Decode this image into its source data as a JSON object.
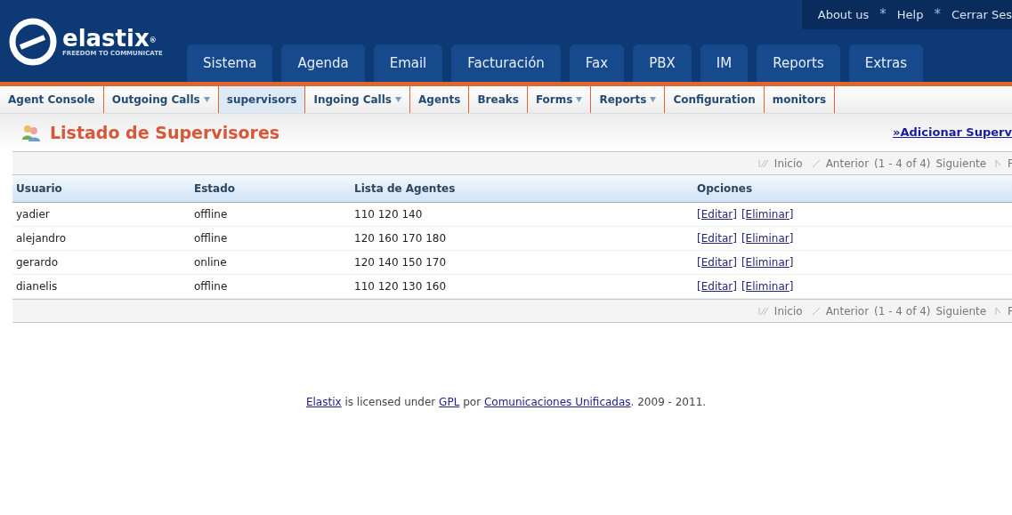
{
  "header": {
    "logo": {
      "name": "elastix",
      "mark": "®",
      "tagline": "FREEDOM TO COMMUNICATE"
    },
    "top_links": [
      {
        "kind": "link",
        "text": "About us"
      },
      {
        "kind": "separator",
        "text": "*"
      },
      {
        "kind": "link",
        "text": "Help"
      },
      {
        "kind": "separator",
        "text": "*"
      },
      {
        "kind": "link",
        "text": "Cerrar Ses"
      }
    ],
    "tabs": [
      {
        "label": "Sistema",
        "selected": false
      },
      {
        "label": "Agenda",
        "selected": false
      },
      {
        "label": "Email",
        "selected": false
      },
      {
        "label": "Facturación",
        "selected": false
      },
      {
        "label": "Fax",
        "selected": false
      },
      {
        "label": "PBX",
        "selected": false
      },
      {
        "label": "IM",
        "selected": false
      },
      {
        "label": "Reports",
        "selected": false
      },
      {
        "label": "Extras",
        "selected": false
      }
    ]
  },
  "submenu": [
    {
      "label": "Agent Console",
      "has_menu": false,
      "selected": false
    },
    {
      "label": "Outgoing Calls",
      "has_menu": true,
      "selected": false
    },
    {
      "label": "supervisors",
      "has_menu": false,
      "selected": true
    },
    {
      "label": "Ingoing Calls",
      "has_menu": true,
      "selected": false
    },
    {
      "label": "Agents",
      "has_menu": false,
      "selected": false
    },
    {
      "label": "Breaks",
      "has_menu": false,
      "selected": false
    },
    {
      "label": "Forms",
      "has_menu": true,
      "selected": false
    },
    {
      "label": "Reports",
      "has_menu": true,
      "selected": false
    },
    {
      "label": "Configuration",
      "has_menu": false,
      "selected": false
    },
    {
      "label": "monitors",
      "has_menu": false,
      "selected": false
    }
  ],
  "page": {
    "title": "Listado de Supervisores",
    "add_link": "»Adicionar Superv"
  },
  "pagination_top": {
    "first": "Inicio",
    "previous": "Anterior",
    "range": "(1 - 4 of 4)",
    "next": "Siguiente",
    "last": "F"
  },
  "pagination_bottom": {
    "first": "Inicio",
    "previous": "Anterior",
    "range": "(1 - 4 of 4)",
    "next": "Siguiente",
    "last": "F"
  },
  "table": {
    "columns": [
      "Usuario",
      "Estado",
      "Lista de Agentes",
      "Opciones"
    ],
    "rows": [
      {
        "user": "yadier",
        "status": "offline",
        "agents": "110 120 140",
        "actions": [
          "[Editar]",
          "[Eliminar]"
        ]
      },
      {
        "user": "alejandro",
        "status": "offline",
        "agents": "120 160 170 180",
        "actions": [
          "[Editar]",
          "[Eliminar]"
        ]
      },
      {
        "user": "gerardo",
        "status": "online",
        "agents": "120 140 150 170",
        "actions": [
          "[Editar]",
          "[Eliminar]"
        ]
      },
      {
        "user": "dianelis",
        "status": "offline",
        "agents": "110 120 130 160",
        "actions": [
          "[Editar]",
          "[Eliminar]"
        ]
      }
    ]
  },
  "footer": [
    {
      "text": "Elastix",
      "link": true
    },
    {
      "text": "is licensed under",
      "link": false
    },
    {
      "text": "GPL",
      "link": true
    },
    {
      "text": "por",
      "link": false
    },
    {
      "text": "Comunicaciones Unificadas",
      "link": true
    },
    {
      "text": ". 2009 - 2011.",
      "link": false
    }
  ]
}
